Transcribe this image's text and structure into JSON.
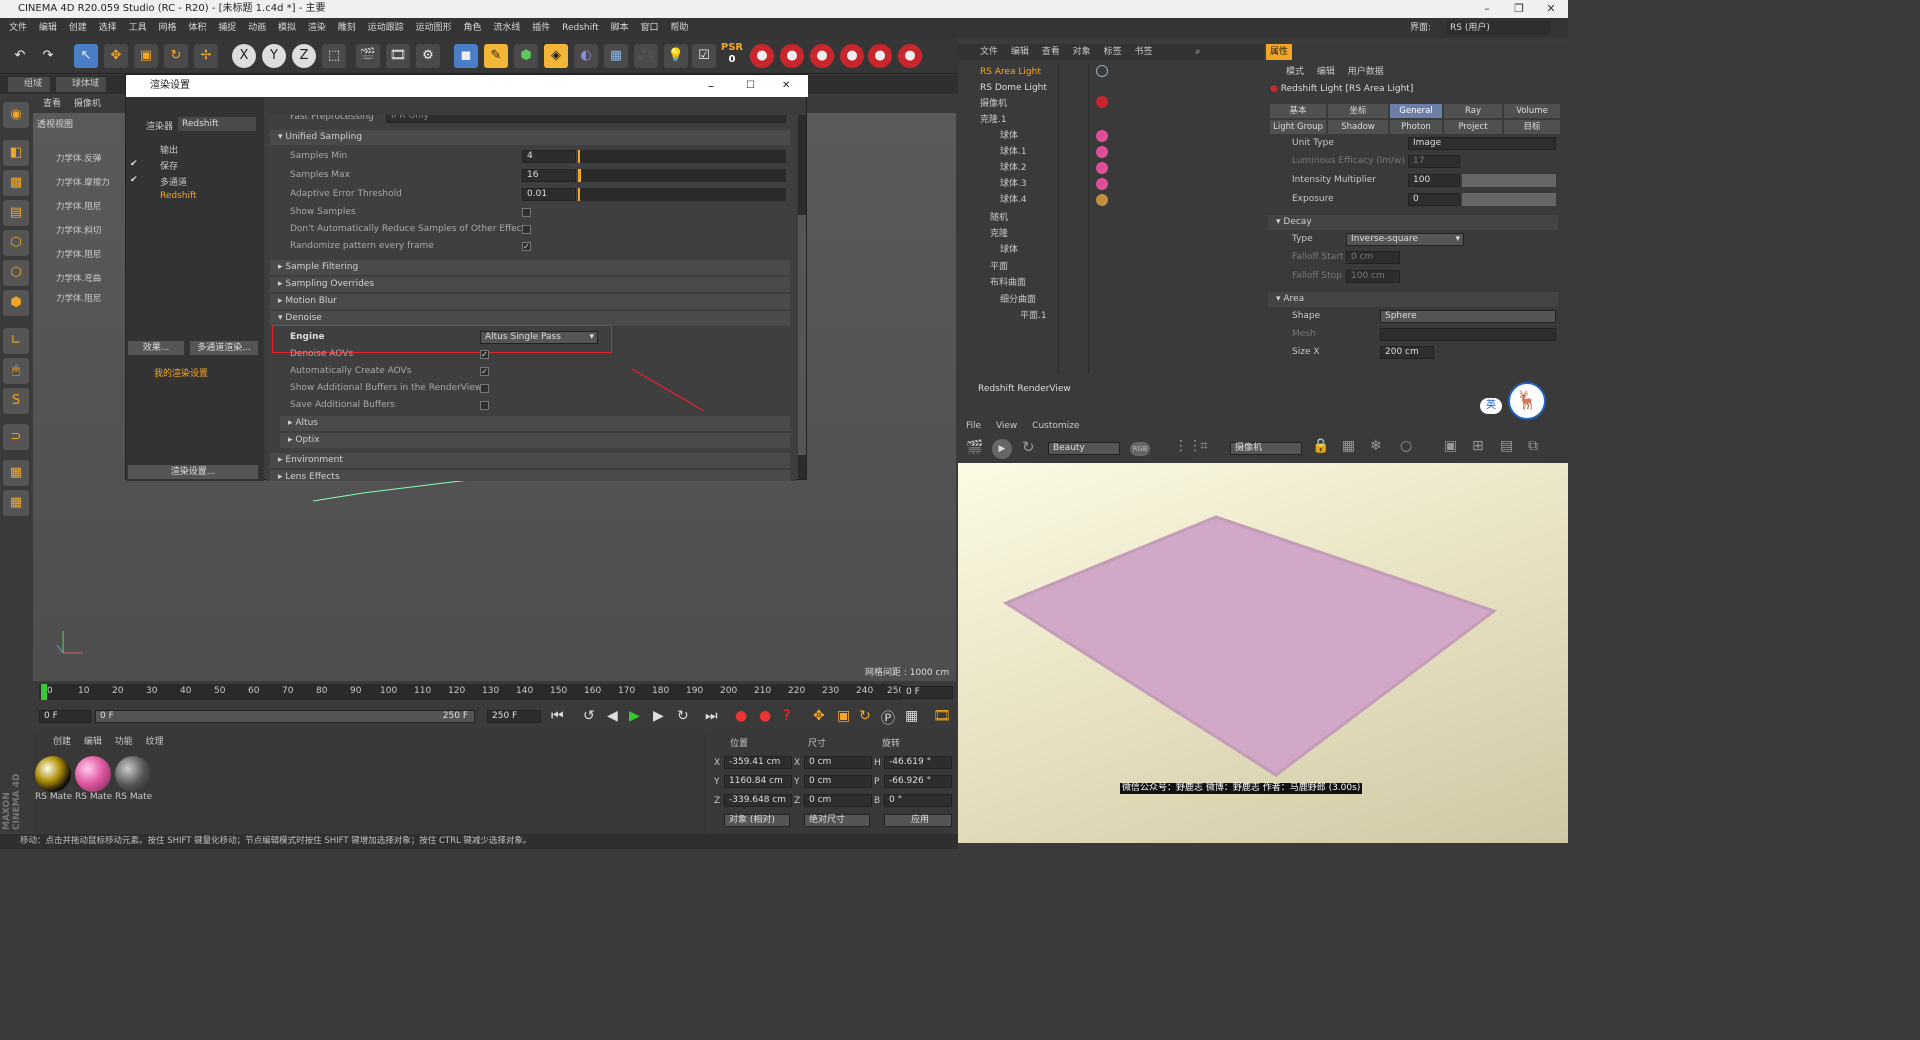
{
  "window": {
    "title": "CINEMA 4D R20.059 Studio (RC - R20) - [未标题 1.c4d *] - 主要",
    "interface_label": "界面:",
    "interface_value": "RS (用户)"
  },
  "menu": [
    "文件",
    "编辑",
    "创建",
    "选择",
    "工具",
    "网格",
    "体积",
    "捕捉",
    "动画",
    "模拟",
    "渲染",
    "雕刻",
    "运动跟踪",
    "运动图形",
    "角色",
    "流水线",
    "插件",
    "Redshift",
    "脚本",
    "窗口",
    "帮助"
  ],
  "toolbar": {
    "psr_label": "PSR",
    "psr_value": "0",
    "x": "X",
    "y": "Y",
    "z": "Z"
  },
  "tabs_left": [
    "组域",
    "球体域"
  ],
  "viewport": {
    "menu": [
      "查看",
      "摄像机"
    ],
    "label": "透视视图",
    "grid_info": "网格间距 : 1000 cm",
    "objects": [
      "力学体.反弹",
      "力学体.摩擦力",
      "力学体.阻尼",
      "力学体.斜切",
      "力学体.阻尼",
      "力学体.阻尼",
      "力学体.弯曲",
      "力学体.阻尼"
    ]
  },
  "render_settings": {
    "title": "渲染设置",
    "renderer_label": "渲染器",
    "renderer_value": "Redshift",
    "side_items": [
      "输出",
      "保存",
      "多通道",
      "Redshift"
    ],
    "effects_btn": "效果...",
    "multipass_btn": "多通道渲染...",
    "my_settings": "我的渲染设置",
    "settings_btn": "渲染设置...",
    "fast_preprocessing_label": "Fast Preprocessing",
    "fast_preprocessing_value": "IPR Only",
    "unified_sampling": "Unified Sampling",
    "samples_min_label": "Samples Min",
    "samples_min": "4",
    "samples_max_label": "Samples Max",
    "samples_max": "16",
    "aet_label": "Adaptive Error Threshold",
    "aet": "0.01",
    "show_samples": "Show Samples",
    "dont_reduce": "Don't Automatically Reduce Samples of Other Effects",
    "randomize": "Randomize pattern every frame",
    "sample_filtering": "Sample Filtering",
    "sampling_overrides": "Sampling Overrides",
    "motion_blur": "Motion Blur",
    "denoise": "Denoise",
    "engine_label": "Engine",
    "engine_value": "Altus Single Pass",
    "denoise_aovs": "Denoise AOVs",
    "auto_aovs": "Automatically Create AOVs",
    "show_buffers": "Show Additional Buffers in the RenderView",
    "save_buffers": "Save Additional Buffers",
    "altus": "Altus",
    "optix": "Optix",
    "environment": "Environment",
    "lens_effects": "Lens Effects"
  },
  "object_manager": {
    "menu": [
      "文件",
      "编辑",
      "查看",
      "对象",
      "标签",
      "书签"
    ],
    "items": [
      "RS Area Light",
      "RS Dome Light",
      "摄像机",
      "克隆.1",
      "球体",
      "球体.1",
      "球体.2",
      "球体.3",
      "球体.4",
      "随机",
      "克隆",
      "球体",
      "平面",
      "布料曲面",
      "细分曲面",
      "平面.1"
    ]
  },
  "attributes": {
    "tab": "属性",
    "menu": [
      "模式",
      "编辑",
      "用户数据"
    ],
    "header": "Redshift Light [RS Area Light]",
    "tabs1": [
      "基本",
      "坐标",
      "General",
      "Ray",
      "Volume"
    ],
    "tabs2": [
      "Light Group",
      "Shadow",
      "Photon",
      "Project",
      "目标"
    ],
    "unit_type_label": "Unit Type",
    "unit_type": "Image",
    "luminous_label": "Luminous Efficacy (lm/w)",
    "luminous": "17",
    "intensity_label": "Intensity Multiplier",
    "intensity": "100",
    "exposure_label": "Exposure",
    "exposure": "0",
    "decay": "Decay",
    "type_label": "Type",
    "type_value": "Inverse-square",
    "falloff_start_label": "Falloff Start",
    "falloff_start": "0 cm",
    "falloff_stop_label": "Falloff Stop",
    "falloff_stop": "100 cm",
    "area": "Area",
    "shape_label": "Shape",
    "shape_value": "Sphere",
    "mesh_label": "Mesh",
    "sizex_label": "Size X",
    "sizex": "200 cm"
  },
  "renderview": {
    "title": "Redshift RenderView",
    "menu": [
      "File",
      "View",
      "Customize"
    ],
    "aov": "Beauty",
    "rgb": "RGB",
    "camera": "摄像机",
    "caption": "微信公众号：野鹿志  微博：野鹿志  作者：马鹿野郎 (3.00s)",
    "ime": "英"
  },
  "timeline": {
    "ticks": [
      "0",
      "10",
      "20",
      "30",
      "40",
      "50",
      "60",
      "70",
      "80",
      "90",
      "100",
      "110",
      "120",
      "130",
      "140",
      "150",
      "160",
      "170",
      "180",
      "190",
      "200",
      "210",
      "220",
      "230",
      "240",
      "250"
    ],
    "cur": "0 F",
    "start": "0 F",
    "range_start": "0 F",
    "range_end": "250 F",
    "end": "250 F"
  },
  "materials": {
    "menu": [
      "创建",
      "编辑",
      "功能",
      "纹理"
    ],
    "items": [
      "RS Mate",
      "RS Mate",
      "RS Mate"
    ]
  },
  "coords": {
    "headers": [
      "位置",
      "尺寸",
      "旋转"
    ],
    "pos": [
      "-359.41 cm",
      "1160.84 cm",
      "-339.648 cm"
    ],
    "size": [
      "0 cm",
      "0 cm",
      "0 cm"
    ],
    "rot": [
      "-46.619 °",
      "-66.926 °",
      "0 °"
    ],
    "axis_p": [
      "X",
      "Y",
      "Z"
    ],
    "axis_r": [
      "H",
      "P",
      "B"
    ],
    "mode": "对象 (相对)",
    "sizemode": "绝对尺寸",
    "apply": "应用"
  },
  "status": "移动：点击并拖动鼠标移动元素。按住 SHIFT 键量化移动；节点编辑模式时按住 SHIFT 键增加选择对象；按住 CTRL 键减少选择对象。"
}
